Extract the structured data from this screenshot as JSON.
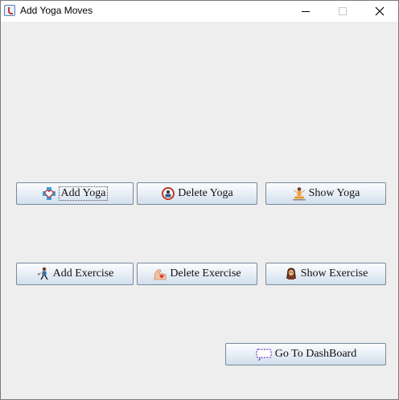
{
  "window": {
    "title": "Add Yoga Moves",
    "controls": {
      "minimize": "minimize",
      "maximize": "maximize",
      "close": "close"
    }
  },
  "buttons": {
    "add_yoga": {
      "label": "Add Yoga",
      "icon": "first-aid-heart-icon"
    },
    "delete_yoga": {
      "label": "Delete Yoga",
      "icon": "person-badge-icon"
    },
    "show_yoga": {
      "label": "Show Yoga",
      "icon": "yoga-pose-icon"
    },
    "add_exercise": {
      "label": "Add Exercise",
      "icon": "runner-icon"
    },
    "delete_exercise": {
      "label": "Delete Exercise",
      "icon": "flexed-arm-heart-icon"
    },
    "show_exercise": {
      "label": "Show Exercise",
      "icon": "person-portrait-icon"
    },
    "go_dashboard": {
      "label": "Go To DashBoard",
      "icon": "speech-bubble-icon"
    }
  },
  "colors": {
    "window_bg": "#eeeeee",
    "button_border": "#7a8a99",
    "button_gradient_top": "#fbfcfe",
    "button_gradient_bottom": "#d2dfee"
  }
}
